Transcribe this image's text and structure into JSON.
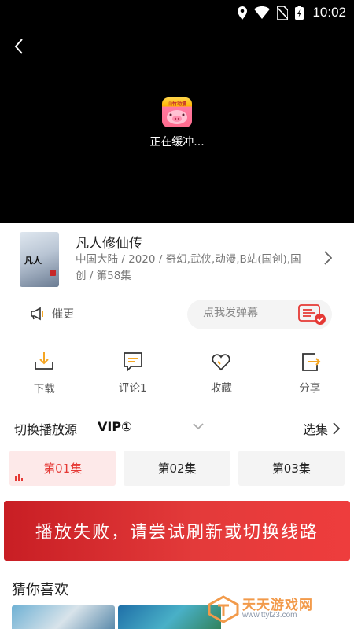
{
  "status_bar": {
    "time": "10:02"
  },
  "player": {
    "loading_text": "正在缓冲...",
    "logo_text": "山竹动漫"
  },
  "show": {
    "title": "凡人修仙传",
    "meta": "中国大陆 / 2020 / 奇幻,武侠,动漫,B站(国创),国创 / 第58集",
    "poster_title": "凡人"
  },
  "urge": {
    "label": "催更"
  },
  "danmaku": {
    "placeholder": "点我发弹幕"
  },
  "actions": [
    {
      "label": "下载",
      "icon": "download-icon"
    },
    {
      "label": "评论1",
      "icon": "comment-icon"
    },
    {
      "label": "收藏",
      "icon": "heart-icon"
    },
    {
      "label": "分享",
      "icon": "share-icon"
    }
  ],
  "source": {
    "label": "切换播放源",
    "value": "VIP①",
    "select_label": "选集"
  },
  "episodes": [
    {
      "label": "第01集",
      "active": true
    },
    {
      "label": "第02集",
      "active": false
    },
    {
      "label": "第03集",
      "active": false
    }
  ],
  "error": {
    "message": "播放失败，请尝试刷新或切换线路"
  },
  "recommend": {
    "title": "猜你喜欢"
  },
  "watermark": {
    "name": "天天游戏网",
    "url": "www.ttyl23.com"
  },
  "colors": {
    "accent": "#e53935",
    "banner": "#d9272e",
    "watermark": "#f29a4a"
  }
}
